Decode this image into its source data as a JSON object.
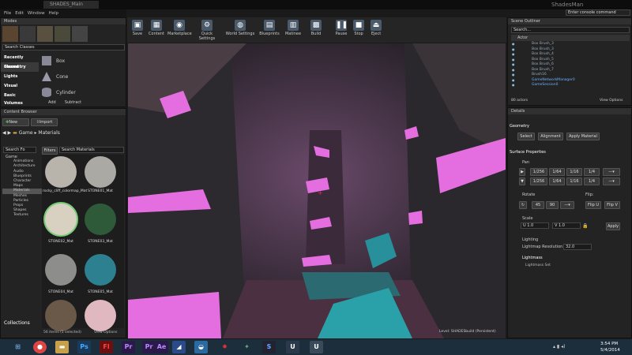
{
  "window": {
    "tab_title": "SHADES_Main",
    "app_title": "ShadesMan",
    "search_placeholder": "Enter console command"
  },
  "menu": [
    "File",
    "Edit",
    "Window",
    "Help"
  ],
  "modes": {
    "title": "Modes",
    "search_placeholder": "Search Classes",
    "categories": [
      "Recently Placed",
      "Geometry",
      "Lights",
      "Visual",
      "Basic",
      "Volumes"
    ],
    "items": [
      "Box",
      "Cone",
      "Cylinder"
    ],
    "add_label": "Add",
    "subtract_label": "Subtract"
  },
  "toolbar": [
    "Save",
    "Content",
    "Marketplace",
    "Quick Settings",
    "World Settings",
    "Blueprints",
    "Matinee",
    "Build",
    "Pause",
    "Stop",
    "Eject"
  ],
  "content_browser": {
    "title": "Content Browser",
    "new_label": "New",
    "import_label": "Import",
    "path": [
      "Game",
      "Materials"
    ],
    "folder_search": "Search Fo",
    "filters_label": "Filters",
    "asset_search": "Search Materials",
    "folders": [
      "Game",
      "Animations",
      "Architecture",
      "Audio",
      "Blueprints",
      "Character",
      "Maps",
      "Materials",
      "Meshes",
      "Particles",
      "Props",
      "Shapes",
      "Textures"
    ],
    "assets": [
      {
        "name": "rocky_cliff_colormap_Mat",
        "color": "#b8b4ac"
      },
      {
        "name": "STONE01_Mat",
        "color": "#aaa9a4"
      },
      {
        "name": "STONE02_Mat",
        "color": "#d8d0c0"
      },
      {
        "name": "STONE03_Mat",
        "color": "#2e5a3a"
      },
      {
        "name": "STONE04_Mat",
        "color": "#8d8d8b"
      },
      {
        "name": "STONE05_Mat",
        "color": "#2c8090"
      },
      {
        "name": "",
        "color": "#6a5848"
      },
      {
        "name": "",
        "color": "#e0b8c0"
      }
    ],
    "count": "56 items (1 selected)",
    "view_options": "View Options",
    "collections": "Collections"
  },
  "viewport": {
    "level": "Level: SHADESbuild (Persistent)"
  },
  "outliner": {
    "title": "Scene Outliner",
    "search_placeholder": "Search...",
    "column": "Actor",
    "rows": [
      "Box Brush_3",
      "Box Brush_3",
      "Box Brush_4",
      "Box Brush_5",
      "Box Brush_6",
      "Box Brush_7",
      "Brush16",
      "GameNetworkManager0",
      "GameSession0"
    ],
    "count": "80 actors",
    "view_options": "View Options"
  },
  "details": {
    "title": "Details",
    "geometry": "Geometry",
    "select": "Select",
    "alignment": "Alignment",
    "apply_material": "Apply Material",
    "surface_properties": "Surface Properties",
    "pan": "Pan",
    "pan_vals": [
      "1/256",
      "1/64",
      "1/16",
      "1/4"
    ],
    "rotate": "Rotate",
    "rotate_vals": [
      "45",
      "90"
    ],
    "flip": "Flip:",
    "flip_u": "Flip U",
    "flip_v": "Flip V",
    "scale": "Scale",
    "scale_u": "U  1.0",
    "scale_v": "V  1.0",
    "apply": "Apply",
    "lighting": "Lighting",
    "lightmap_res": "Lightmap Resolution",
    "lightmap_val": "32.0",
    "lightmass": "Lightmass",
    "lightmass_set": "Lightmass Set"
  },
  "clock": {
    "time": "3:54 PM",
    "date": "5/4/2014"
  }
}
